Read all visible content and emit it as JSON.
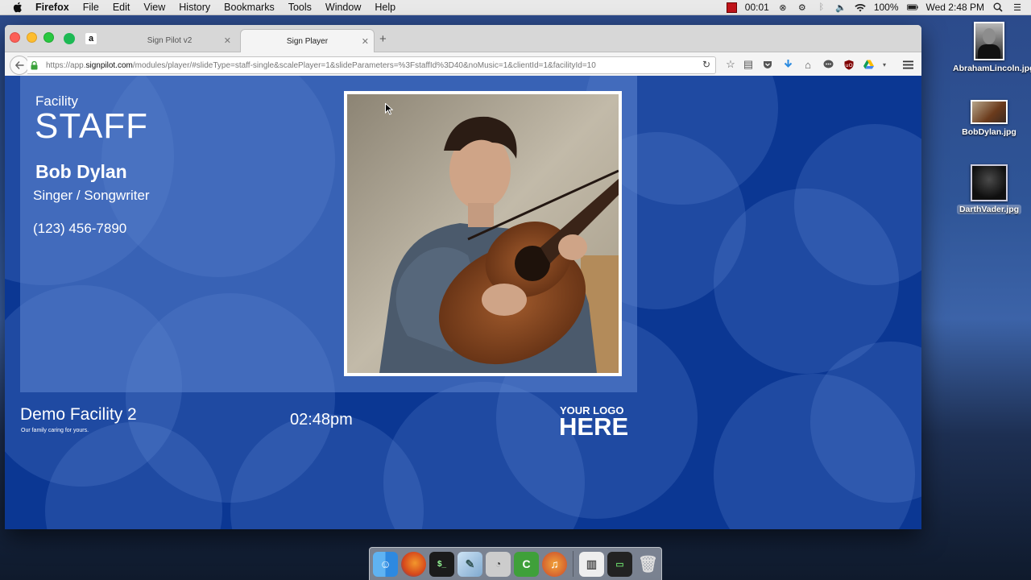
{
  "menubar": {
    "app_name": "Firefox",
    "menus": [
      "File",
      "Edit",
      "View",
      "History",
      "Bookmarks",
      "Tools",
      "Window",
      "Help"
    ],
    "recording_time": "00:01",
    "battery": "100%",
    "clock": "Wed 2:48 PM"
  },
  "desktop": {
    "files": [
      {
        "label": "AbrahamLincoln.jpg"
      },
      {
        "label": "BobDylan.jpg"
      },
      {
        "label": "DarthVader.jpg"
      }
    ]
  },
  "browser": {
    "tabs": [
      {
        "label": "Sign Pilot v2",
        "active": false
      },
      {
        "label": "Sign Player",
        "active": true
      }
    ],
    "url_prefix": "https://app.",
    "url_domain": "signpilot.com",
    "url_rest": "/modules/player/#slideType=staff-single&scalePlayer=1&slideParameters=%3FstaffId%3D40&noMusic=1&clientId=1&facilityId=10"
  },
  "slide": {
    "section_label": "Facility",
    "section_title": "STAFF",
    "staff_name": "Bob Dylan",
    "staff_role": "Singer / Songwriter",
    "staff_phone": "(123) 456-7890",
    "facility_name": "Demo Facility 2",
    "facility_tagline": "Our family caring for yours.",
    "time": "02:48pm",
    "logo_line1": "YOUR LOGO",
    "logo_line2": "HERE"
  },
  "colors": {
    "slide_background": "#0b3793",
    "panel_overlay": "#5f87d2"
  }
}
